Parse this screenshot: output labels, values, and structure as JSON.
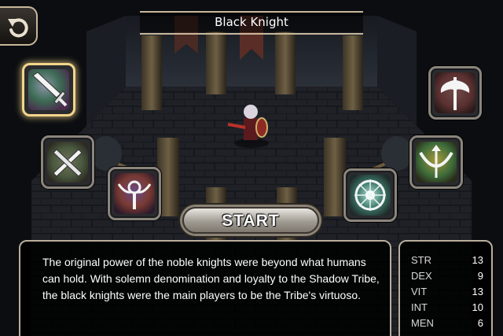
{
  "header": {
    "title": "Black Knight"
  },
  "start_button": {
    "label": "START"
  },
  "description": "The original power of the noble knights were beyond what humans can hold. With solemn denomination and loyalty to the Shadow Tribe, the black knights were the main players to be the Tribe's virtuoso.",
  "stats": [
    {
      "name": "STR",
      "value": "13"
    },
    {
      "name": "DEX",
      "value": "9"
    },
    {
      "name": "VIT",
      "value": "13"
    },
    {
      "name": "INT",
      "value": "10"
    },
    {
      "name": "MEN",
      "value": "6"
    }
  ],
  "class_icons": [
    {
      "icon": "sword-icon",
      "selected": true
    },
    {
      "icon": "crossed-daggers-icon",
      "selected": false
    },
    {
      "icon": "winged-staff-icon",
      "selected": false
    },
    {
      "icon": "battle-axe-icon",
      "selected": false
    },
    {
      "icon": "bow-icon",
      "selected": false
    },
    {
      "icon": "compass-orb-icon",
      "selected": false
    }
  ],
  "colors": {
    "accent": "#f2d58a",
    "frame": "#b9ae9c",
    "text": "#ffffff"
  }
}
